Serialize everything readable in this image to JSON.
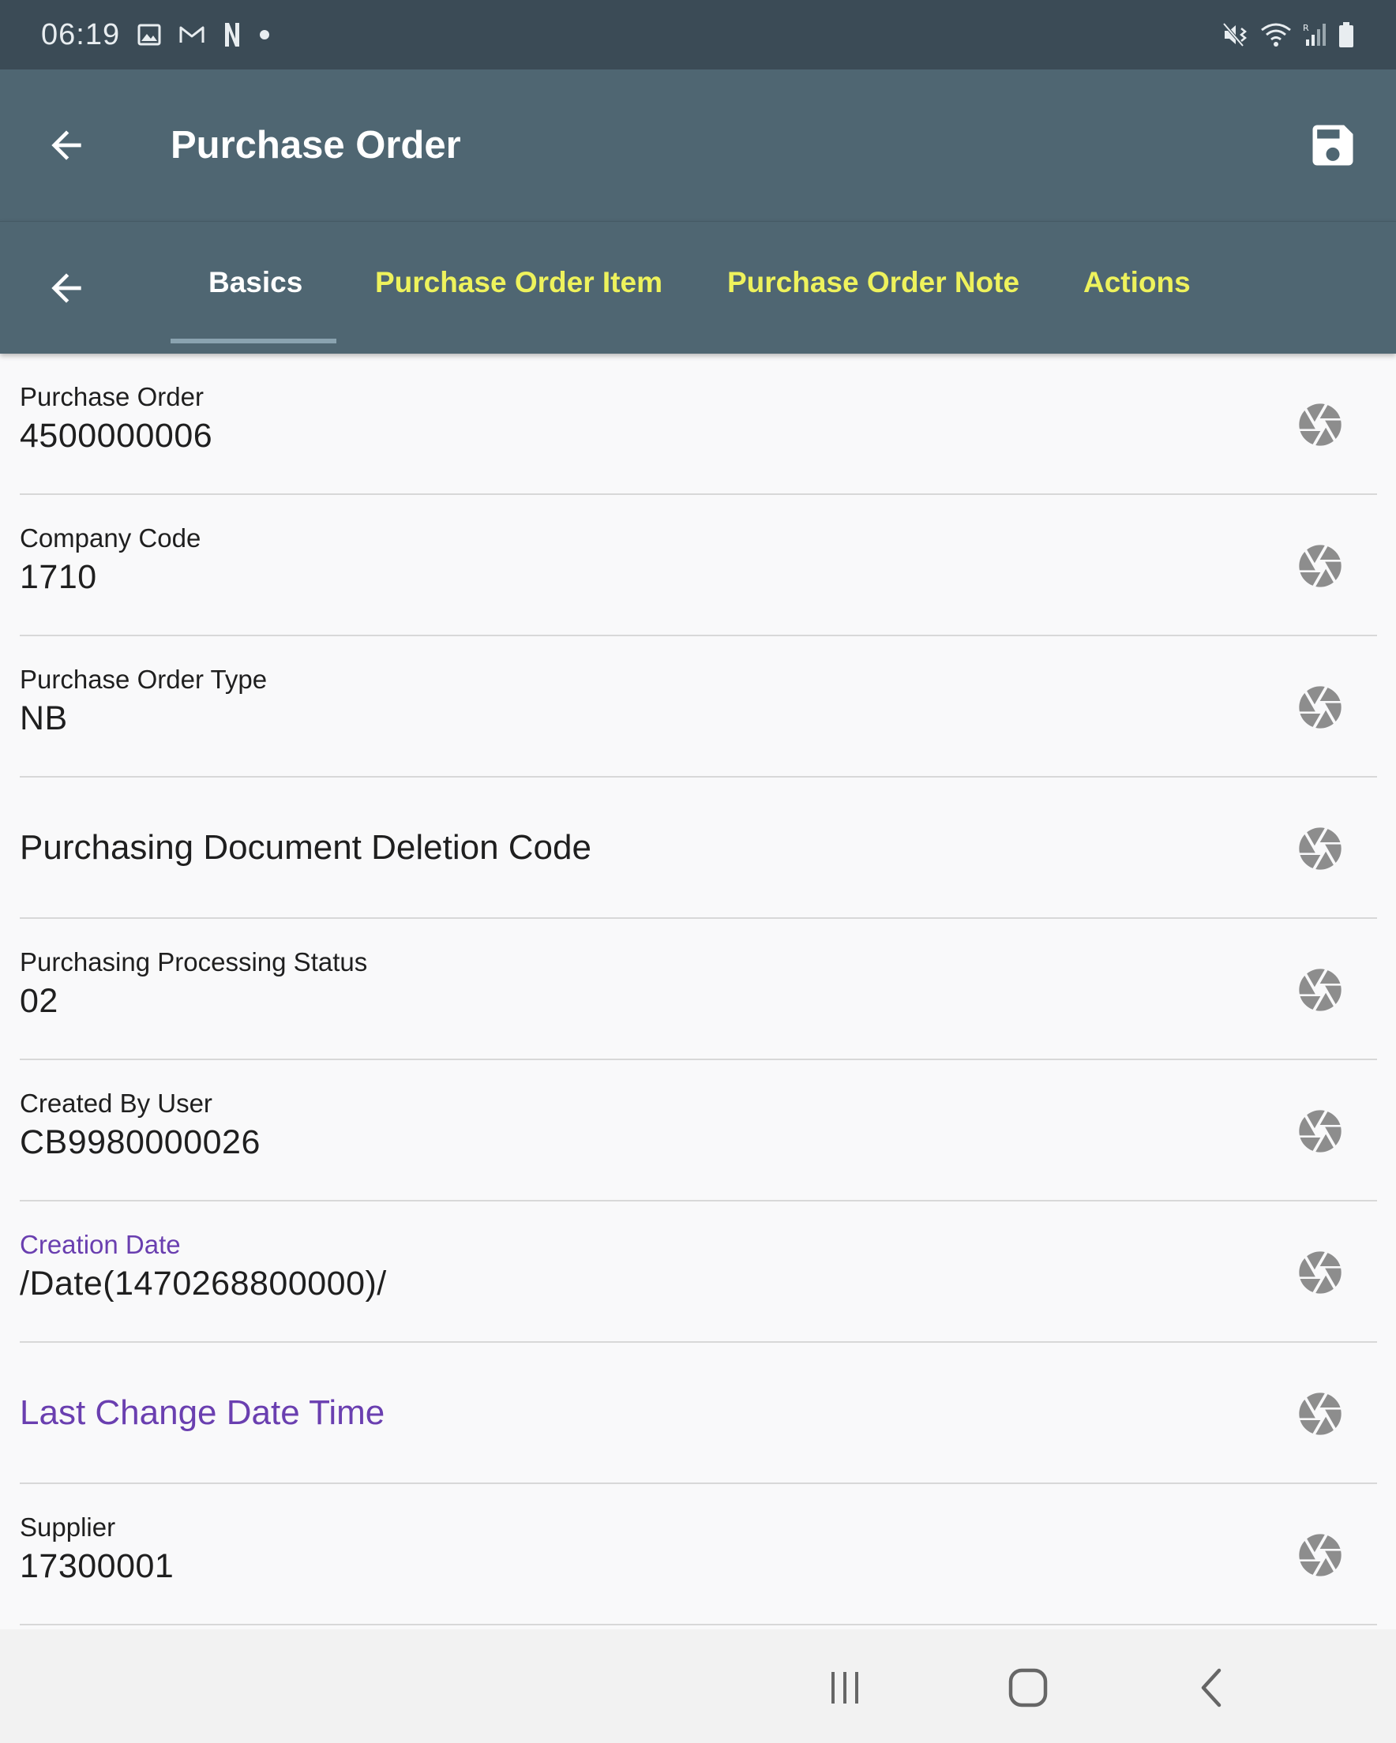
{
  "status_bar": {
    "time": "06:19",
    "left_icons": [
      "image-icon",
      "gmail-icon",
      "n-app-icon",
      "dot-icon"
    ],
    "right_icons": [
      "mute-vibrate-icon",
      "wifi-icon",
      "signal-icon",
      "battery-icon"
    ]
  },
  "app_bar": {
    "title": "Purchase Order",
    "back_icon": "arrow-back-icon",
    "save_icon": "save-icon"
  },
  "tabs": [
    {
      "label": "Basics",
      "active": true
    },
    {
      "label": "Purchase Order Item",
      "active": false
    },
    {
      "label": "Purchase Order Note",
      "active": false
    },
    {
      "label": "Actions",
      "active": false
    }
  ],
  "colors": {
    "status_bar": "#3b4b56",
    "app_bar": "#4f6672",
    "tab_active": "#ffffff",
    "tab_inactive": "#eef25c",
    "purple_label": "#6a3fb0",
    "background": "#f9f9fa"
  },
  "fields": [
    {
      "label": "Purchase Order",
      "value": "4500000006"
    },
    {
      "label": "Company Code",
      "value": "1710"
    },
    {
      "label": "Purchase Order Type",
      "value": "NB"
    },
    {
      "label": "Purchasing Document Deletion Code",
      "value": ""
    },
    {
      "label": "Purchasing Processing Status",
      "value": "02"
    },
    {
      "label": "Created By User",
      "value": "CB9980000026"
    },
    {
      "label": "Creation Date",
      "value": "/Date(1470268800000)/"
    },
    {
      "label": "Last Change Date Time",
      "value": ""
    },
    {
      "label": "Supplier",
      "value": "17300001"
    }
  ],
  "nav_bar": {
    "icons": [
      "recent-apps-icon",
      "home-icon",
      "back-icon"
    ]
  }
}
